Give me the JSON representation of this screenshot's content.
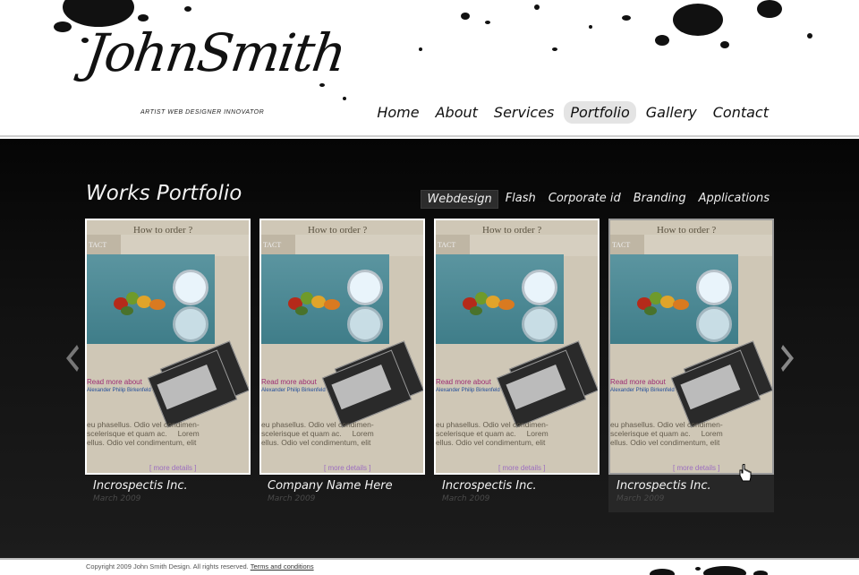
{
  "logo": {
    "text": "JohnSmith",
    "tagline": "ARTIST   WEB DESIGNER   INNOVATOR"
  },
  "nav": {
    "items": [
      {
        "label": "Home"
      },
      {
        "label": "About"
      },
      {
        "label": "Services"
      },
      {
        "label": "Portfolio",
        "active": true
      },
      {
        "label": "Gallery"
      },
      {
        "label": "Contact"
      }
    ]
  },
  "portfolio": {
    "title": "Works Portfolio",
    "filters": [
      {
        "label": "Webdesign",
        "active": true
      },
      {
        "label": "Flash"
      },
      {
        "label": "Corporate id"
      },
      {
        "label": "Branding"
      },
      {
        "label": "Applications"
      }
    ],
    "thumb": {
      "tab": "TACT",
      "order": "How to order ?",
      "link": "Read more about",
      "name": "Alexander Philip Birkenfeld",
      "body": "eu phasellus. Odio vel condimen-\nscelerisque et quam ac.     Lorem\nellus. Odio vel condimentum, elit",
      "more": "[ more details ]"
    },
    "cards": [
      {
        "title": "Incrospectis Inc.",
        "date": "March 2009"
      },
      {
        "title": "Company Name Here",
        "date": "March 2009"
      },
      {
        "title": "Incrospectis Inc.",
        "date": "March 2009"
      },
      {
        "title": "Incrospectis Inc.",
        "date": "March 2009",
        "hover": true
      }
    ]
  },
  "footer": {
    "copyright": "Copyright 2009 John Smith Design. All rights reserved.",
    "terms": "Terms and conditions"
  },
  "colors": {
    "background_dark": "#111111",
    "accent_link": "#9c2c72"
  }
}
